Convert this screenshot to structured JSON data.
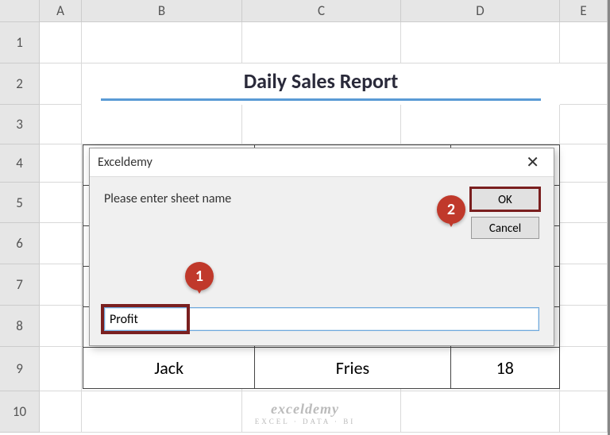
{
  "columns": [
    "A",
    "B",
    "C",
    "D",
    "E"
  ],
  "rows": [
    "1",
    "2",
    "3",
    "4",
    "5",
    "6",
    "7",
    "8",
    "9",
    "10"
  ],
  "title": "Daily Sales Report",
  "data_row": {
    "c1": "Jack",
    "c2": "Fries",
    "c3": "18"
  },
  "dialog": {
    "title": "Exceldemy",
    "prompt": "Please enter sheet name",
    "ok": "OK",
    "cancel": "Cancel",
    "close": "✕",
    "input_value": "Profit"
  },
  "callouts": {
    "one": "1",
    "two": "2"
  },
  "watermark": {
    "top": "exceldemy",
    "bot": "EXCEL · DATA · BI"
  }
}
